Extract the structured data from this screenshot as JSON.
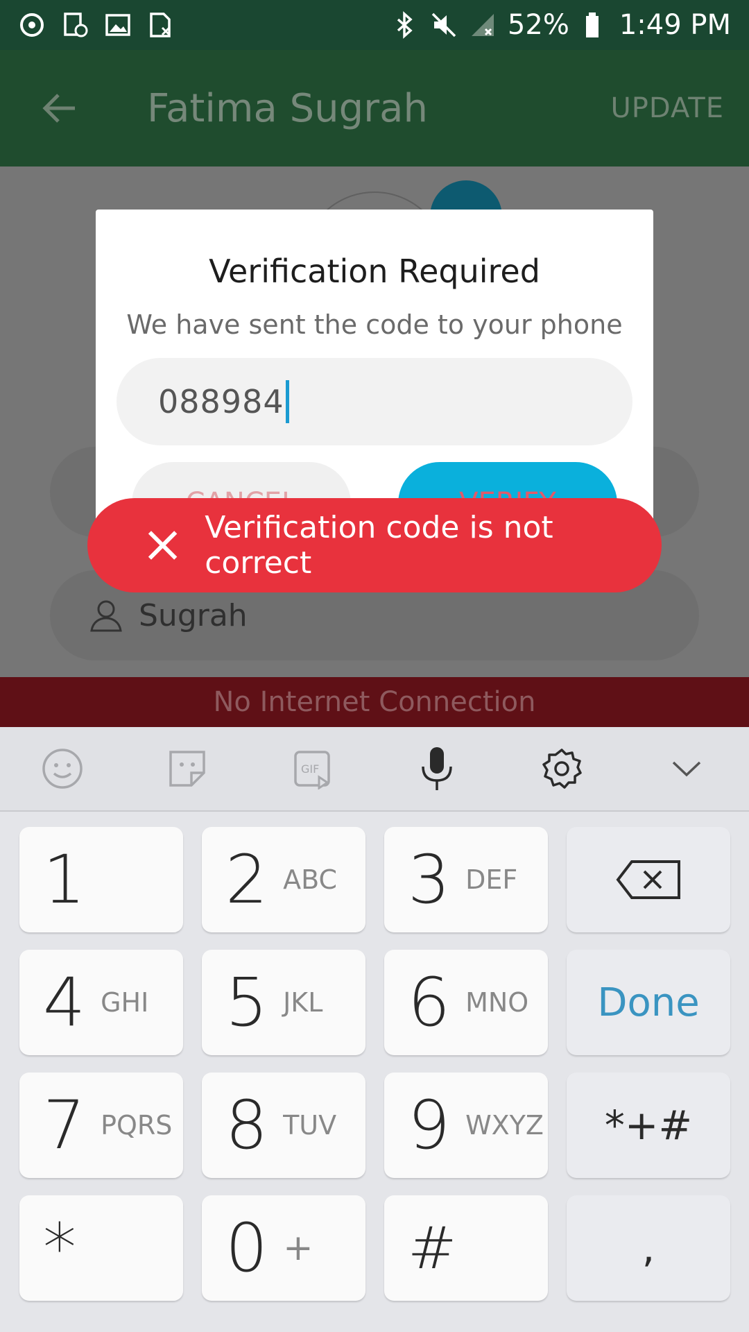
{
  "status_bar": {
    "battery": "52%",
    "time": "1:49 PM"
  },
  "app_bar": {
    "title": "Fatima Sugrah",
    "action": "UPDATE"
  },
  "form": {
    "last_name": "Sugrah"
  },
  "banner": {
    "text": "No Internet Connection"
  },
  "dialog": {
    "title": "Verification Required",
    "subtitle": "We have sent the code to your phone",
    "code_value": "088984",
    "cancel_label": "CANCEL",
    "verify_label": "VERIFY"
  },
  "toast": {
    "message": "Verification code is not correct"
  },
  "keyboard": {
    "toolbar": [
      "emoji-icon",
      "sticker-icon",
      "gif-icon",
      "microphone-icon",
      "settings-icon",
      "chevron-down-icon"
    ],
    "keys": {
      "k1": {
        "num": "1",
        "sub": ""
      },
      "k2": {
        "num": "2",
        "sub": "ABC"
      },
      "k3": {
        "num": "3",
        "sub": "DEF"
      },
      "k4": {
        "num": "4",
        "sub": "GHI"
      },
      "k5": {
        "num": "5",
        "sub": "JKL"
      },
      "k6": {
        "num": "6",
        "sub": "MNO"
      },
      "k7": {
        "num": "7",
        "sub": "PQRS"
      },
      "k8": {
        "num": "8",
        "sub": "TUV"
      },
      "k9": {
        "num": "9",
        "sub": "WXYZ"
      },
      "k0": {
        "num": "0",
        "sub": "+"
      },
      "star": "*",
      "hash": "#",
      "done": "Done",
      "symbols": "*+#",
      "comma": ","
    }
  },
  "colors": {
    "status_bar": "#1a4731",
    "app_bar": "#1f4c2e",
    "toast": "#e8323d",
    "verify": "#0ab0dc",
    "banner": "#5f1016"
  }
}
